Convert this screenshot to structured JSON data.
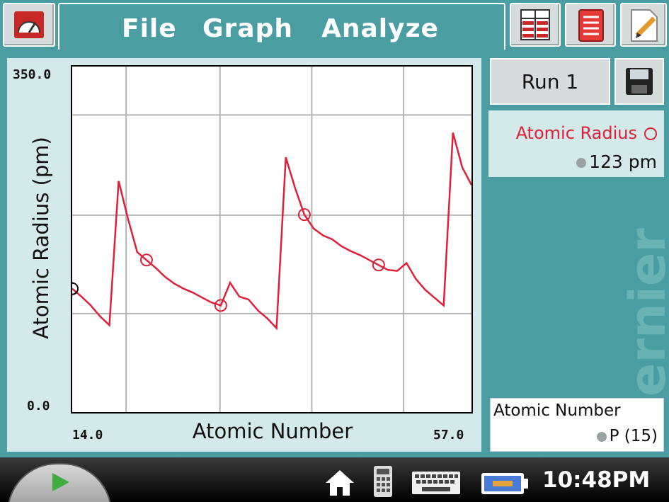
{
  "menu": {
    "file": "File",
    "graph": "Graph",
    "analyze": "Analyze"
  },
  "toolbar_icons": [
    "meter-icon",
    "graph-icon",
    "table-icon",
    "notebook-icon",
    "notes-icon"
  ],
  "run": {
    "label": "Run 1"
  },
  "meter": {
    "sensor_label": "Atomic Radius",
    "value": "123 pm"
  },
  "x_readout": {
    "label": "Atomic Number",
    "value": "P (15)"
  },
  "clock": "10:48PM",
  "colors": {
    "accent": "#4a9ea1",
    "series": "#e0203a"
  },
  "chart_data": {
    "type": "line",
    "xlabel": "Atomic Number",
    "ylabel": "Atomic Radius (pm)",
    "xlim": [
      14,
      57
    ],
    "ylim": [
      0,
      350
    ],
    "x_min_label": "14.0",
    "x_max_label": "57.0",
    "y_max_label": "350.0",
    "y_min_label": "0.0",
    "grid": true,
    "series": [
      {
        "x": [
          14,
          15,
          16,
          17,
          18,
          19,
          20,
          21,
          22,
          23,
          24,
          25,
          26,
          27,
          28,
          29,
          30,
          31,
          32,
          33,
          34,
          35,
          36,
          37,
          38,
          39,
          40,
          41,
          42,
          43,
          44,
          45,
          46,
          47,
          48,
          49,
          50,
          51,
          52,
          53,
          54,
          55,
          56,
          57
        ],
        "y": [
          125,
          117,
          108,
          97,
          88,
          234,
          196,
          162,
          154,
          146,
          137,
          130,
          125,
          121,
          116,
          111,
          108,
          131,
          117,
          114,
          103,
          95,
          85,
          258,
          227,
          200,
          186,
          179,
          175,
          168,
          163,
          159,
          154,
          149,
          144,
          143,
          151,
          135,
          124,
          116,
          108,
          283,
          248,
          230
        ],
        "markers_x": [
          14,
          22,
          30,
          39,
          47
        ]
      }
    ]
  }
}
